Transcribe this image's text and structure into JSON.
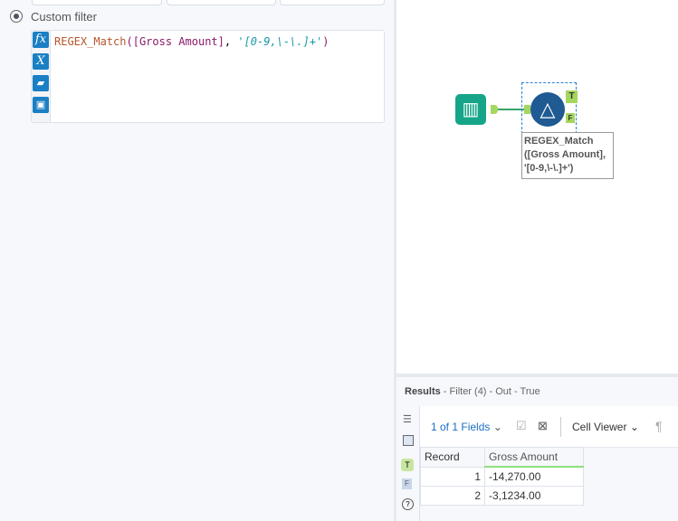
{
  "filter": {
    "custom_label": "Custom filter",
    "expression": {
      "fn": "REGEX_Match",
      "open": "(",
      "bracket_open": "[",
      "field": "Gross Amount",
      "bracket_close": "]",
      "sep": ", ",
      "pattern": "'[0-9,\\-\\.]+'",
      "close": ")"
    }
  },
  "canvas": {
    "tool_annotation": "REGEX_Match ([Gross Amount], '[0-9,\\-\\.]+')",
    "true_anchor": "T",
    "false_anchor": "F"
  },
  "results": {
    "title": "Results",
    "subtitle": " - Filter (4) - Out - True",
    "fields_selector": "1 of 1 Fields",
    "cell_viewer": "Cell Viewer",
    "columns": [
      "Record",
      "Gross Amount"
    ],
    "rows": [
      {
        "record": "1",
        "value": "-14,270.00"
      },
      {
        "record": "2",
        "value": "-3,1234.00"
      }
    ],
    "side_true": "T",
    "side_false": "F"
  }
}
